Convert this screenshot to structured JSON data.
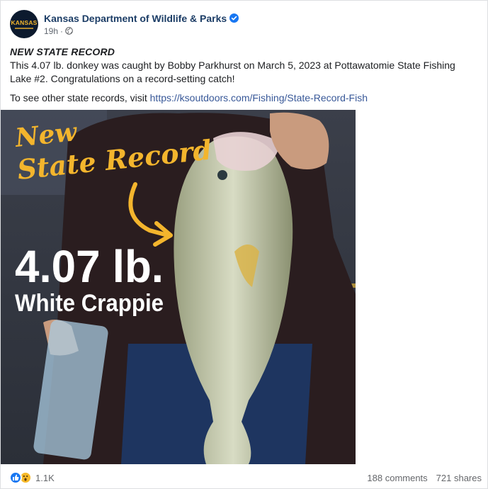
{
  "page": {
    "name": "Kansas Department of Wildlife & Parks",
    "avatar_text": "KANSAS",
    "timestamp": "19h",
    "separator": "·"
  },
  "post": {
    "headline": "NEW STATE RECORD",
    "body": "This 4.07 lb. donkey was caught by Bobby Parkhurst on March 5, 2023 at Pottawatomie State Fishing Lake #2. Congratulations on a record-setting catch!",
    "link_prefix": "To see other state records, visit ",
    "link_text": "https://ksoutdoors.com/Fishing/State-Record-Fish"
  },
  "image": {
    "overlay_line1": "New",
    "overlay_line2": "State Record",
    "weight": "4.07 lb.",
    "species": "White Crappie"
  },
  "footer": {
    "reaction_count": "1.1K",
    "comments": "188 comments",
    "shares": "721 shares"
  },
  "colors": {
    "brand_dark": "#1c3d66",
    "accent_gold": "#f3b52d",
    "link": "#385898",
    "like_blue": "#1877f2",
    "wow_yellow": "#f7b928"
  },
  "icons": [
    "verified-badge-icon",
    "globe-icon",
    "like-reaction-icon",
    "wow-reaction-icon",
    "arrow-icon"
  ]
}
